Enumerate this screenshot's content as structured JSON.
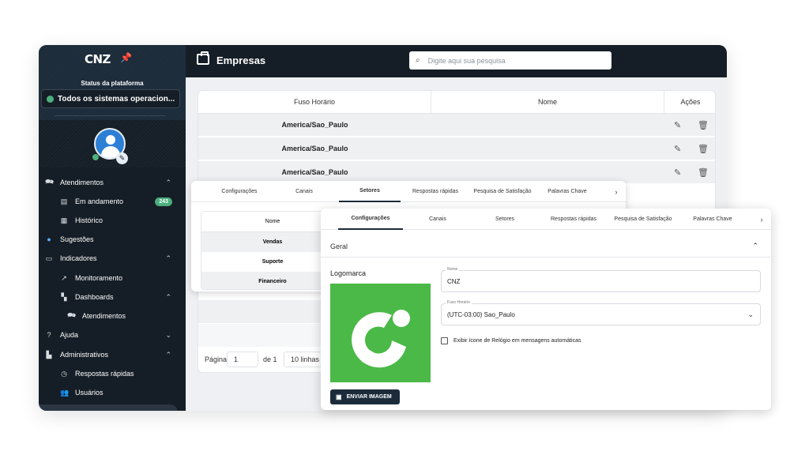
{
  "sidebar": {
    "logo": "CNZ",
    "status_title": "Status da plataforma",
    "status_text": "Todos os sistemas operacion...",
    "items": [
      {
        "label": "Atendimentos",
        "icon": "chat-icon",
        "chevron": "⌃"
      },
      {
        "label": "Em andamento",
        "icon": "list-icon",
        "badge": "243"
      },
      {
        "label": "Histórico",
        "icon": "history-icon"
      },
      {
        "label": "Sugestões",
        "icon": "lightbulb-icon"
      },
      {
        "label": "Indicadores",
        "icon": "chart-icon",
        "chevron": "⌃"
      },
      {
        "label": "Monitoramento",
        "icon": "trend-icon"
      },
      {
        "label": "Dashboards",
        "icon": "dashboard-icon",
        "chevron": "⌃"
      },
      {
        "label": "Atendimentos",
        "icon": "chat-icon"
      },
      {
        "label": "Ajuda",
        "icon": "help-icon",
        "chevron": "⌄"
      },
      {
        "label": "Administrativos",
        "icon": "building-icon",
        "chevron": "⌃"
      },
      {
        "label": "Respostas rápidas",
        "icon": "timer-icon"
      },
      {
        "label": "Usuários",
        "icon": "users-icon"
      }
    ]
  },
  "header": {
    "title": "Empresas",
    "search_placeholder": "Digite aqui sua pesquisa"
  },
  "table": {
    "columns": [
      "Fuso Horário",
      "Nome",
      "Ações"
    ],
    "rows": [
      {
        "fuso": "America/Sao_Paulo",
        "nome": ""
      },
      {
        "fuso": "America/Sao_Paulo",
        "nome": ""
      },
      {
        "fuso": "America/Sao_Paulo",
        "nome": ""
      }
    ],
    "pager": {
      "page_label": "Página",
      "page_value": "1",
      "of_label": "de 1",
      "rows_label": "10 linhas"
    }
  },
  "card_a": {
    "tabs": [
      "Configurações",
      "Canais",
      "Setores",
      "Respostas rápidas",
      "Pesquisa de Satisfação",
      "Palavras Chave"
    ],
    "selected_tab": "Setores",
    "inner_header": "Nome",
    "inner_rows": [
      "Vendas",
      "Suporte",
      "Financeiro"
    ]
  },
  "card_b": {
    "tabs": [
      "Configurações",
      "Canais",
      "Setores",
      "Respostas rápidas",
      "Pesquisa de Satisfação",
      "Palavras Chave"
    ],
    "selected_tab": "Configurações",
    "section_title": "Geral",
    "logo_label": "Logomarca",
    "upload_button": "ENVIAR IMAGEM",
    "name_label": "Nome",
    "name_value": "CNZ",
    "tz_label": "Fuso Horário",
    "tz_value": "(UTC-03:00) Sao_Paulo",
    "checkbox_label": "Exibir ícone de Relógio em mensagens automáticas"
  },
  "colors": {
    "dark": "#151e26",
    "accent_green": "#4caf7d",
    "logo_green": "#4bb947"
  }
}
